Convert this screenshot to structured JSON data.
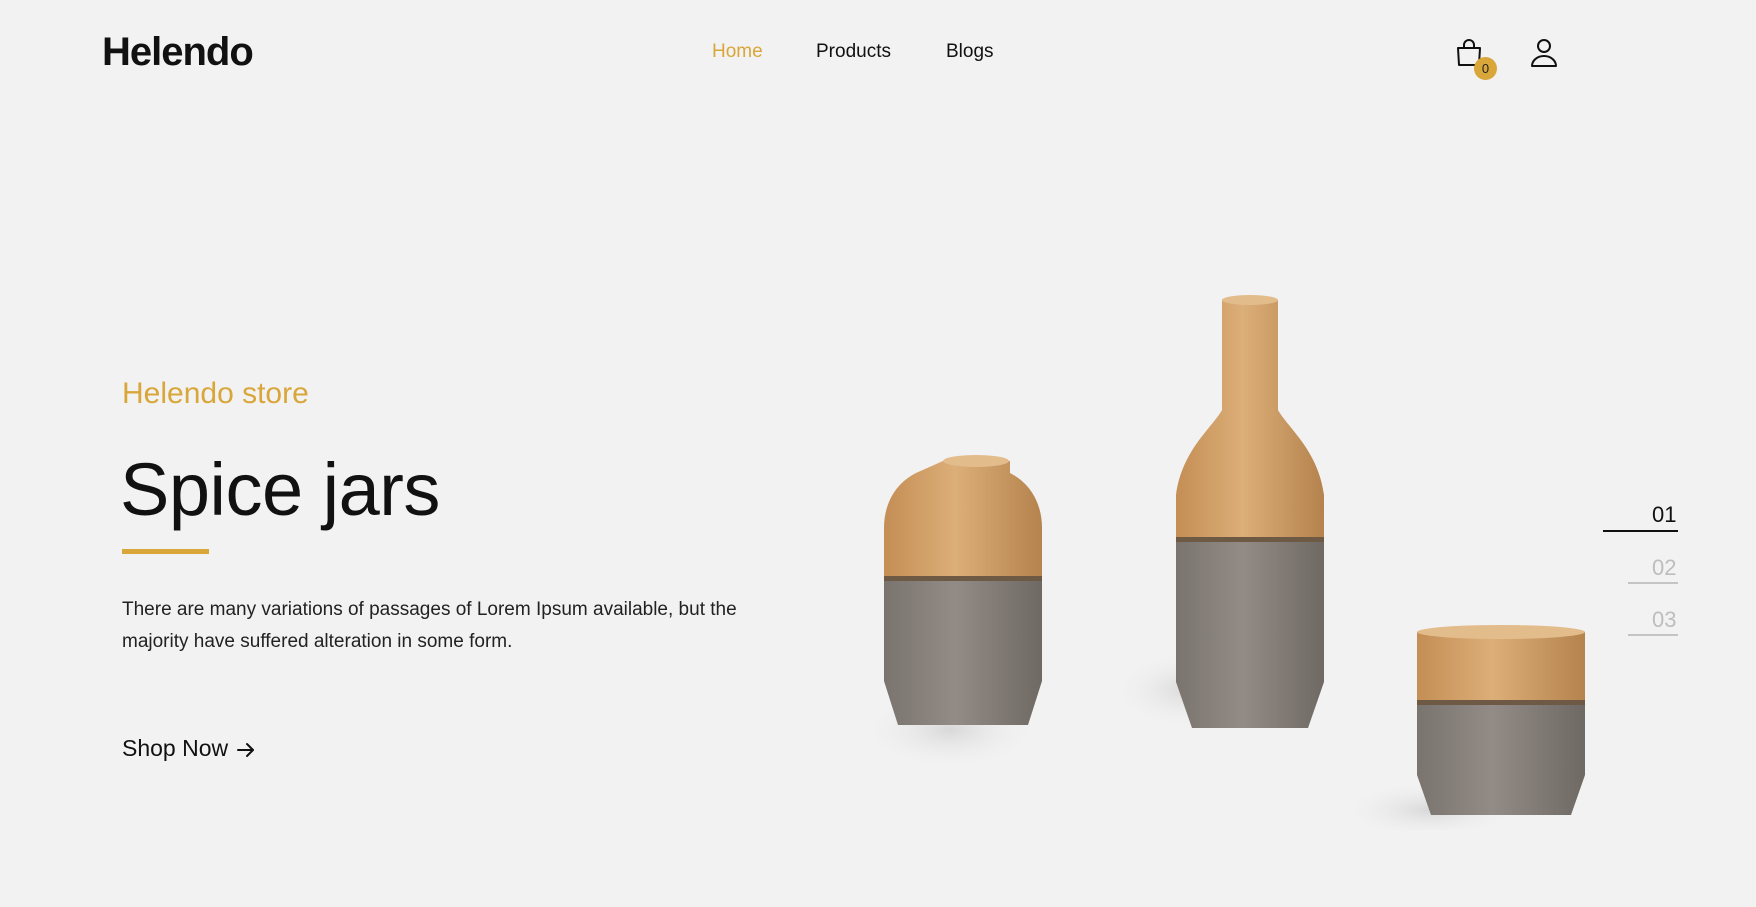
{
  "header": {
    "logo": "Helendo",
    "nav": [
      {
        "label": "Home",
        "active": true
      },
      {
        "label": "Products",
        "active": false
      },
      {
        "label": "Blogs",
        "active": false
      }
    ],
    "cart_count": "0",
    "icons": [
      "shopping-bag-icon",
      "user-icon"
    ]
  },
  "hero": {
    "eyebrow": "Helendo store",
    "title": "Spice jars",
    "description": "There are many variations of passages of Lorem Ipsum available, but the majority have suffered alteration in some form.",
    "cta": "Shop Now",
    "cta_icon": "arrow-right-icon",
    "image": "spice-jars-product-image"
  },
  "pager": {
    "items": [
      "01",
      "02",
      "03"
    ],
    "active_index": 0
  },
  "colors": {
    "background": "#f2f2f2",
    "accent": "#d9a63a",
    "text": "#111111",
    "inactive": "#bdbdbd"
  }
}
